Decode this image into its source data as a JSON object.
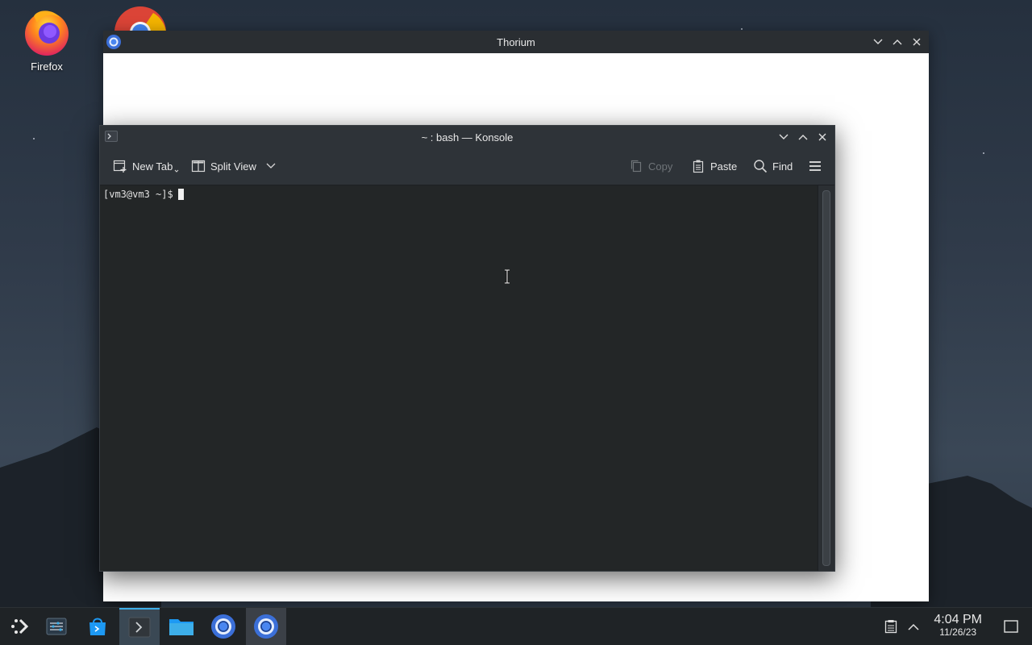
{
  "desktop": {
    "icons": [
      {
        "label": "Firefox",
        "icon": "firefox-icon"
      },
      {
        "label": "",
        "icon": "chrome-icon"
      }
    ]
  },
  "thorium_window": {
    "title": "Thorium",
    "icon": "thorium-icon"
  },
  "konsole_window": {
    "title": "~ : bash — Konsole",
    "icon": "konsole-icon",
    "toolbar": {
      "new_tab": "New Tab",
      "split_view": "Split View",
      "copy": "Copy",
      "paste": "Paste",
      "find": "Find"
    },
    "terminal": {
      "prompt": "[vm3@vm3 ~]$"
    }
  },
  "taskbar": {
    "items": [
      "application-launcher-icon",
      "task-switcher-icon",
      "discover-icon",
      "konsole-icon",
      "dolphin-files-icon",
      "thorium-icon",
      "thorium-icon"
    ],
    "clock": {
      "time": "4:04 PM",
      "date": "11/26/23"
    }
  },
  "colors": {
    "accent": "#3daee9",
    "terminal_bg": "#232627",
    "titlebar_bg": "#2e3338"
  }
}
